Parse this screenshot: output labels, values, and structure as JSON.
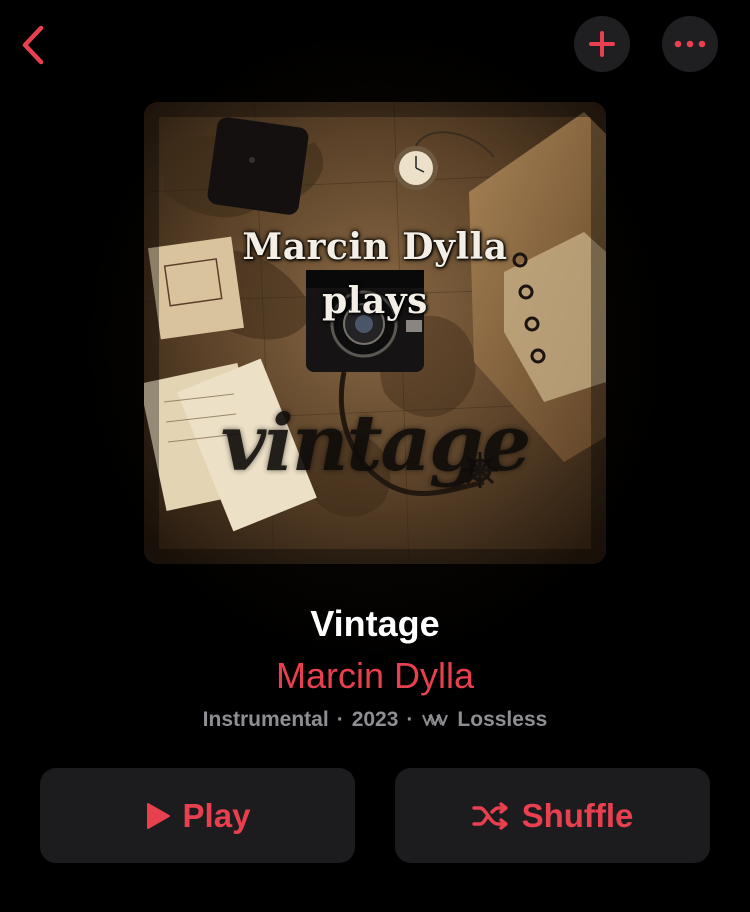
{
  "nav": {
    "back_icon": "chevron-left-icon",
    "add_icon": "plus-icon",
    "more_icon": "ellipsis-icon"
  },
  "artwork": {
    "line1": "Marcin Dylla",
    "line2": "plays",
    "script": "vintage"
  },
  "album": {
    "title": "Vintage",
    "artist": "Marcin Dylla",
    "genre": "Instrumental",
    "separator": "·",
    "year": "2023",
    "quality": "Lossless"
  },
  "actions": {
    "play_label": "Play",
    "shuffle_label": "Shuffle"
  },
  "colors": {
    "accent": "#e8404e",
    "button_bg": "#1c1c1e",
    "secondary_text": "#8e8e93"
  }
}
